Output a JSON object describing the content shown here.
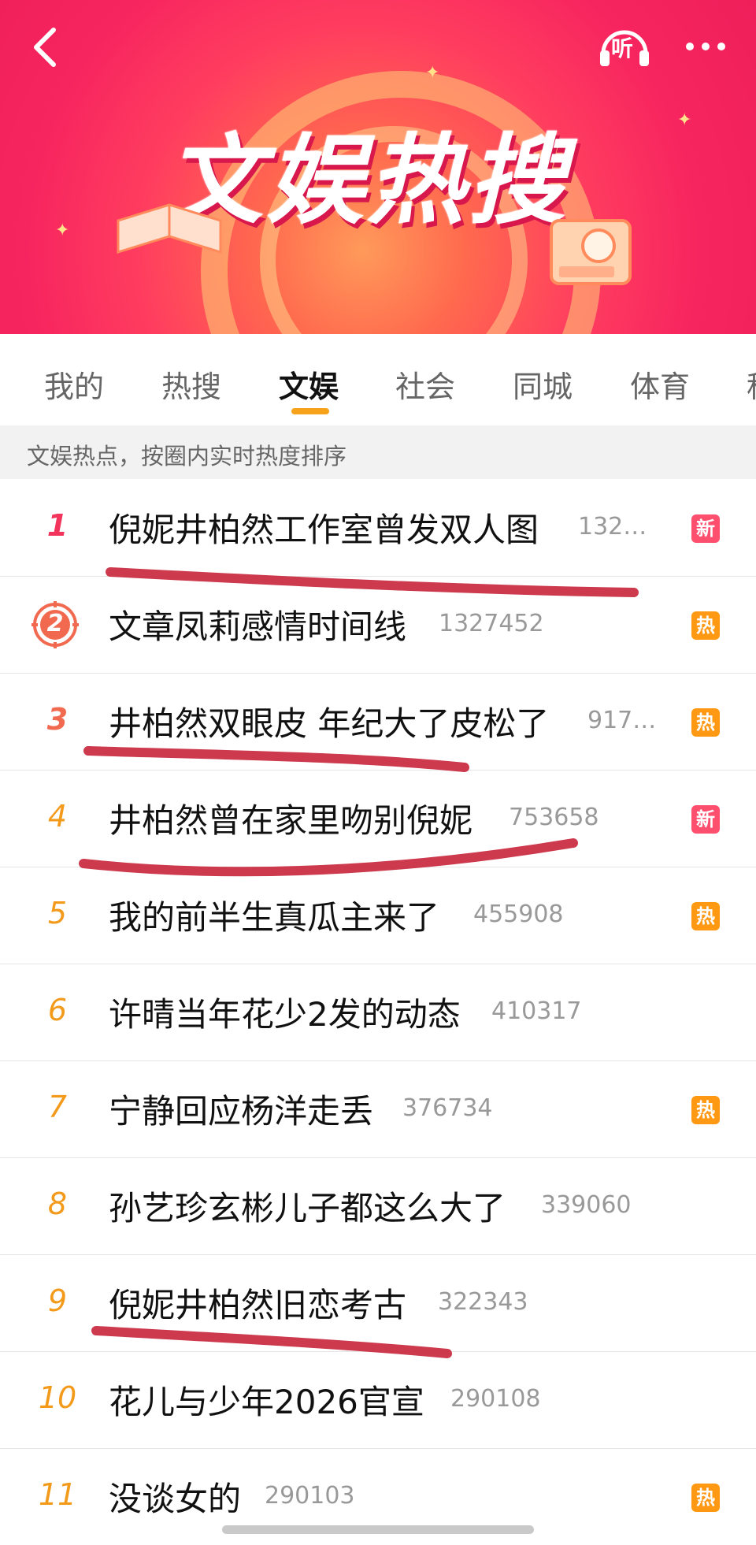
{
  "banner": {
    "title": "文娱热搜",
    "listen_label": "听"
  },
  "tabs": [
    {
      "label": "我的",
      "active": false
    },
    {
      "label": "热搜",
      "active": false
    },
    {
      "label": "文娱",
      "active": true
    },
    {
      "label": "社会",
      "active": false
    },
    {
      "label": "同城",
      "active": false
    },
    {
      "label": "体育",
      "active": false
    },
    {
      "label": "科",
      "active": false
    }
  ],
  "subhead": "文娱热点，按圈内实时热度排序",
  "items": [
    {
      "rank": "1",
      "title": "倪妮井柏然工作室曾发双人图",
      "count": "132…",
      "badge": "新"
    },
    {
      "rank": "2",
      "title": "文章凤莉感情时间线",
      "count": "1327452",
      "badge": "热"
    },
    {
      "rank": "3",
      "title": "井柏然双眼皮 年纪大了皮松了",
      "count": "917…",
      "badge": "热"
    },
    {
      "rank": "4",
      "title": "井柏然曾在家里吻别倪妮",
      "count": "753658",
      "badge": "新"
    },
    {
      "rank": "5",
      "title": "我的前半生真瓜主来了",
      "count": "455908",
      "badge": "热"
    },
    {
      "rank": "6",
      "title": "许晴当年花少2发的动态",
      "count": "410317",
      "badge": ""
    },
    {
      "rank": "7",
      "title": "宁静回应杨洋走丢",
      "count": "376734",
      "badge": "热"
    },
    {
      "rank": "8",
      "title": "孙艺珍玄彬儿子都这么大了",
      "count": "339060",
      "badge": ""
    },
    {
      "rank": "9",
      "title": "倪妮井柏然旧恋考古",
      "count": "322343",
      "badge": ""
    },
    {
      "rank": "10",
      "title": "花儿与少年2026官宣",
      "count": "290108",
      "badge": ""
    },
    {
      "rank": "11",
      "title": "没谈女的",
      "count": "290103",
      "badge": "热"
    }
  ],
  "colors": {
    "rank_top": "#f2335b",
    "rank_mid": "#f16a4f",
    "rank_low": "#f39a1b",
    "badge_new": "#ff4f6e",
    "badge_hot": "#ff9812",
    "tab_accent": "#f7a21b",
    "scribble": "#c8233a"
  },
  "icons": [
    "back-icon",
    "listen-icon",
    "more-icon",
    "rank-medal-icon"
  ]
}
